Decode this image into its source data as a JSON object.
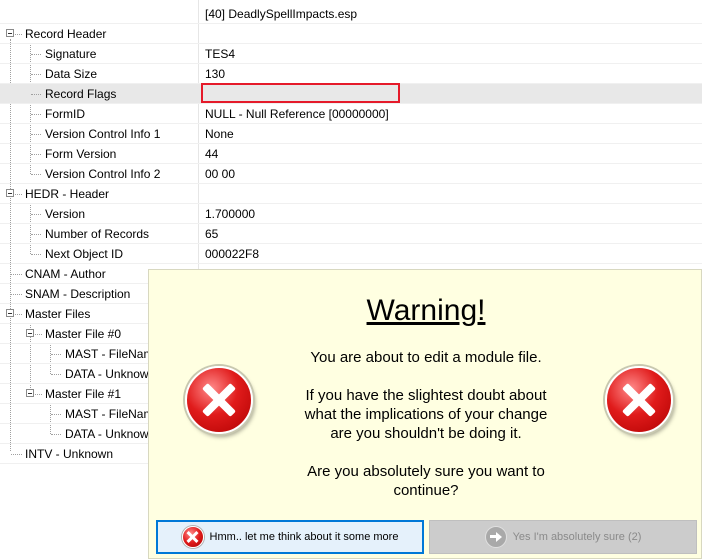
{
  "header": {
    "filename": "[40] DeadlySpellImpacts.esp"
  },
  "tree": {
    "record_header": {
      "label": "Record Header",
      "signature": {
        "label": "Signature",
        "value": "TES4"
      },
      "data_size": {
        "label": "Data Size",
        "value": "130"
      },
      "record_flags": {
        "label": "Record Flags",
        "value": ""
      },
      "form_id": {
        "label": "FormID",
        "value": "NULL - Null Reference [00000000]"
      },
      "vci1": {
        "label": "Version Control Info 1",
        "value": "None"
      },
      "form_version": {
        "label": "Form Version",
        "value": "44"
      },
      "vci2": {
        "label": "Version Control Info 2",
        "value": "00 00"
      }
    },
    "hedr": {
      "label": "HEDR - Header",
      "version": {
        "label": "Version",
        "value": "1.700000"
      },
      "num_records": {
        "label": "Number of Records",
        "value": "65"
      },
      "next_object_id": {
        "label": "Next Object ID",
        "value": "000022F8"
      }
    },
    "cnam": {
      "label": "CNAM - Author"
    },
    "snam": {
      "label": "SNAM - Description"
    },
    "master_files": {
      "label": "Master Files",
      "master0": {
        "label": "Master File #0",
        "mast": "MAST - FileNam",
        "data": "DATA - Unknow"
      },
      "master1": {
        "label": "Master File #1",
        "mast": "MAST - FileNam",
        "data": "DATA - Unknow"
      }
    },
    "intv": {
      "label": "INTV - Unknown"
    }
  },
  "dialog": {
    "title": "Warning!",
    "line1": "You are about to edit a module file.",
    "line2": "If you have the slightest doubt about",
    "line3": "what the implications of your change",
    "line4": "are you shouldn't be doing it.",
    "line5": "Are you absolutely sure you want to",
    "line6": "continue?",
    "icon_left": "error-icon",
    "icon_right": "error-icon",
    "cancel_button": "Hmm.. let me think about it some more",
    "confirm_button": "Yes I'm absolutely sure (2)"
  },
  "colors": {
    "dialog_background": "#ffffe1",
    "highlight_border": "#e51a2a",
    "focus_border": "#0078d7"
  }
}
